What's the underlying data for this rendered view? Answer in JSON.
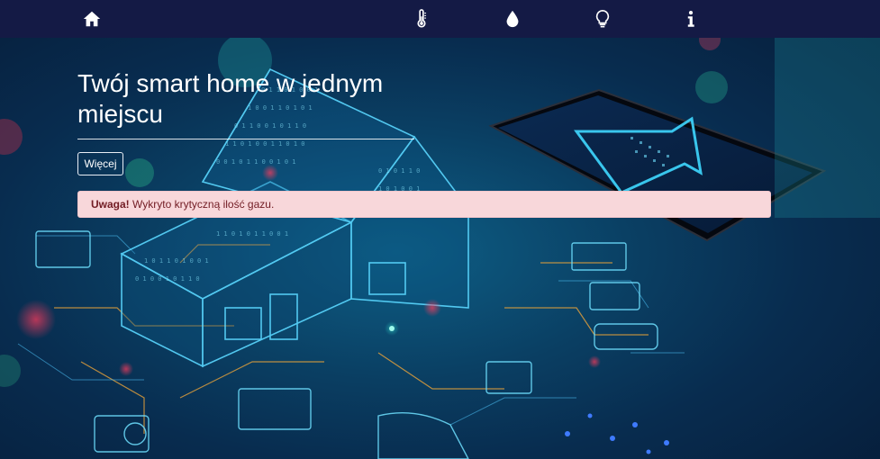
{
  "navbar": {
    "items": [
      {
        "icon": "home-icon"
      },
      {
        "icon": "thermometer-icon"
      },
      {
        "icon": "water-drop-icon"
      },
      {
        "icon": "lightbulb-icon"
      },
      {
        "icon": "info-icon"
      }
    ]
  },
  "hero": {
    "title": "Twój smart home w jednym miejscu",
    "more_label": "Więcej"
  },
  "alert": {
    "strong": "Uwaga!",
    "message": " Wykryto krytyczną ilość gazu."
  },
  "colors": {
    "navbar_bg": "#141a45",
    "alert_bg": "#f8d7da",
    "alert_text": "#721c24",
    "accent_cyan": "#3fd8ff"
  }
}
